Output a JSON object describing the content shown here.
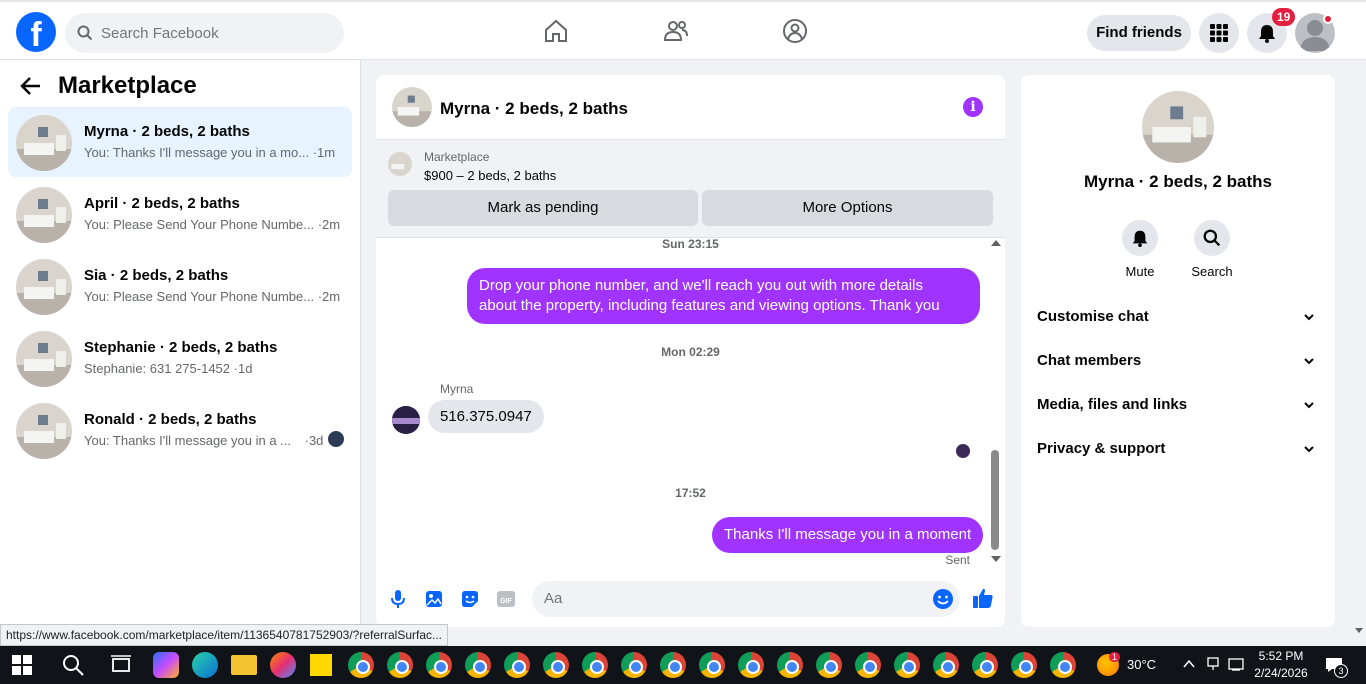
{
  "header": {
    "logo": "f",
    "search_placeholder": "Search Facebook",
    "find_friends": "Find friends",
    "notification_count": "19"
  },
  "left": {
    "title": "Marketplace",
    "conversations": [
      {
        "name": "Myrna · 2 beds, 2 baths",
        "preview": "You: Thanks I'll message you in a mo...",
        "time": "·1m",
        "active": true
      },
      {
        "name": "April · 2 beds, 2 baths",
        "preview": "You: Please Send Your Phone Numbe...",
        "time": "·2m"
      },
      {
        "name": "Sia · 2 beds, 2 baths",
        "preview": "You: Please Send Your Phone Numbe...",
        "time": "·2m"
      },
      {
        "name": "Stephanie · 2 beds, 2 baths",
        "preview": "Stephanie: 631 275-1452",
        "time": "·1d"
      },
      {
        "name": "Ronald · 2 beds, 2 baths",
        "preview": "You: Thanks I'll message you in a ...",
        "time": "·3d"
      }
    ]
  },
  "chat": {
    "title": "Myrna · 2 beds, 2 baths",
    "listing_label": "Marketplace",
    "listing_price": "$900 – 2 beds, 2 baths",
    "mark_pending": "Mark as pending",
    "more_options": "More Options",
    "ts1": "Sun 23:15",
    "msg1_line1": "Drop your phone number, and we'll reach you out with more details",
    "msg1_line2": "about the property, including features and viewing options.  Thank you",
    "ts2": "Mon 02:29",
    "sender": "Myrna",
    "msg2": "516.375.0947",
    "ts3": "17:52",
    "msg3": "Thanks I'll message you in a moment",
    "sent": "Sent",
    "input_placeholder": "Aa"
  },
  "right": {
    "name": "Myrna · 2 beds, 2 baths",
    "mute": "Mute",
    "search": "Search",
    "sections": [
      "Customise chat",
      "Chat members",
      "Media, files and links",
      "Privacy & support"
    ]
  },
  "status_url": "https://www.facebook.com/marketplace/item/1136540781752903/?referralSurfac...",
  "taskbar": {
    "weather": "30°C",
    "time": "5:52 PM",
    "date": "2/24/2026",
    "notif": "3",
    "weather_badge": "1"
  },
  "colors": {
    "accent": "#a033ff",
    "facebook_blue": "#0866ff",
    "active_row": "#e7f3ff"
  }
}
